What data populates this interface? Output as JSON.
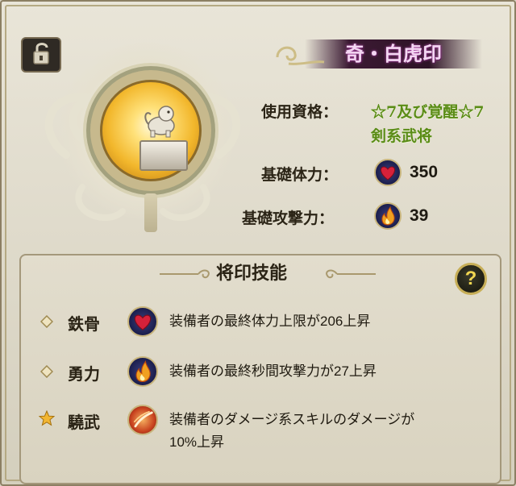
{
  "seal": {
    "title": "奇・白虎印"
  },
  "info": {
    "qualification_label": "使用資格：",
    "qualification_value_line1": "☆7及び覚醒☆7",
    "qualification_value_line2": "剣系武将",
    "hp_label": "基礎体力：",
    "hp_value": "350",
    "atk_label": "基礎攻撃力：",
    "atk_value": "39"
  },
  "skills_panel": {
    "title": "将印技能",
    "help_label": "?",
    "skills": [
      {
        "name": "鉄骨",
        "icon": "heart-icon",
        "desc": "装備者の最終体力上限が206上昇"
      },
      {
        "name": "勇力",
        "icon": "flame-icon",
        "desc": "装備者の最終秒間攻撃力が27上昇"
      },
      {
        "name": "驍武",
        "icon": "slash-icon",
        "desc_line1": "装備者のダメージ系スキルのダメージが",
        "desc_line2": "10%上昇"
      }
    ]
  },
  "colors": {
    "title_text": "#f4d7f3",
    "qualification_green": "#5a8c16",
    "gold": "#c7ae57"
  }
}
